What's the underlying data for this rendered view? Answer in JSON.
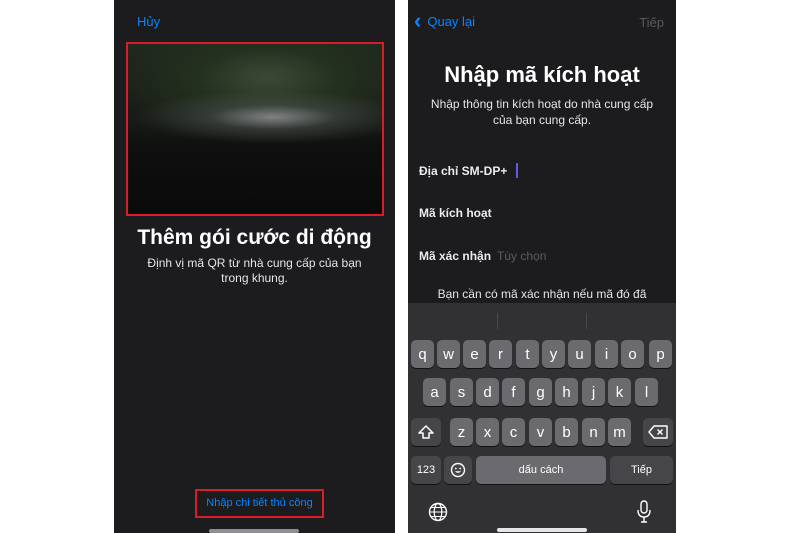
{
  "left_screen": {
    "cancel_label": "Hủy",
    "title": "Thêm gói cước di động",
    "subtitle": "Định vị mã QR từ nhà cung cấp của bạn trong khung.",
    "manual_entry_label": "Nhập chi tiết thủ công"
  },
  "right_screen": {
    "back_label": "Quay lại",
    "next_label": "Tiếp",
    "title": "Nhập mã kích hoạt",
    "subtitle": "Nhập thông tin kích hoạt do nhà cung cấp của bạn cung cấp.",
    "fields": {
      "smdp": {
        "label": "Địa chỉ SM-DP+"
      },
      "activation": {
        "label": "Mã kích hoạt"
      },
      "confirmation": {
        "label": "Mã xác nhận",
        "placeholder": "Tùy chọn"
      }
    },
    "note": "Bạn cần có mã xác nhận nếu mã đó đã"
  },
  "keyboard": {
    "row1": [
      "q",
      "w",
      "e",
      "r",
      "t",
      "y",
      "u",
      "i",
      "o",
      "p"
    ],
    "row2": [
      "a",
      "s",
      "d",
      "f",
      "g",
      "h",
      "j",
      "k",
      "l"
    ],
    "row3": [
      "z",
      "x",
      "c",
      "v",
      "b",
      "n",
      "m"
    ],
    "numbers_label": "123",
    "space_label": "dấu cách",
    "return_label": "Tiếp",
    "icons": [
      "shift-icon",
      "backspace-icon",
      "emoji-icon",
      "globe-icon",
      "microphone-icon"
    ]
  },
  "colors": {
    "accent": "#0a84ff",
    "highlight": "#d71e28",
    "background": "#1c1c1e",
    "keyboard_bg": "#313134",
    "key": "#6b6b6f"
  }
}
